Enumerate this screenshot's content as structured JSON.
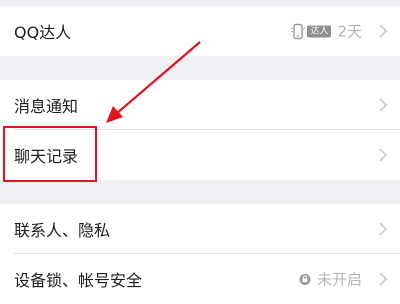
{
  "settings": {
    "group1": [
      {
        "label": "QQ达人",
        "badge_text": "达人",
        "value": "2天"
      }
    ],
    "group2": [
      {
        "label": "消息通知"
      },
      {
        "label": "聊天记录"
      }
    ],
    "group3": [
      {
        "label": "联系人、隐私"
      },
      {
        "label": "设备锁、帐号安全",
        "value": "未开启"
      }
    ]
  },
  "icons": {
    "chevron": "chevron-right-icon",
    "qq_expert_badge": "qq-expert-badge-icon",
    "lock": "lock-icon"
  },
  "colors": {
    "background": "#efeff4",
    "row_background": "#ffffff",
    "secondary_text": "#b6b6b6",
    "annotation": "#e0141e"
  }
}
